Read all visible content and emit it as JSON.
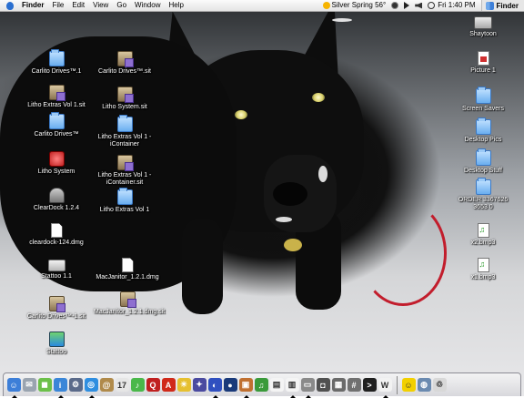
{
  "menubar": {
    "app_name": "Finder",
    "menus": [
      "File",
      "Edit",
      "View",
      "Go",
      "Window",
      "Help"
    ],
    "weather": "Silver Spring 56°",
    "clock": "Fri 1:40 PM",
    "active_app": "Finder"
  },
  "desktop_icons": [
    {
      "label": "Carlito Drives™.1",
      "type": "folder"
    },
    {
      "label": "Carlito Drives™.sit",
      "type": "sit"
    },
    {
      "label": "Litho Extras Vol 1.sit",
      "type": "sit"
    },
    {
      "label": "Litho System.sit",
      "type": "sit"
    },
    {
      "label": "Carlito Drives™",
      "type": "folder"
    },
    {
      "label": "Litho Extras Vol 1 - iContainer",
      "type": "folder"
    },
    {
      "label": "Litho System",
      "type": "app"
    },
    {
      "label": "Litho Extras Vol 1 - iContainer.sit",
      "type": "sit"
    },
    {
      "label": "ClearDock 1.2.4",
      "type": "app"
    },
    {
      "label": "Litho Extras Vol 1",
      "type": "folder"
    },
    {
      "label": "cleardock-124.dmg",
      "type": "doc"
    },
    {
      "label": "Stattoo 1.1",
      "type": "disk"
    },
    {
      "label": "MacJanitor_1.2.1.dmg",
      "type": "doc"
    },
    {
      "label": "Carlito Drives™-1.sit",
      "type": "sit"
    },
    {
      "label": "MacJanitor_1.2.1.dmg.sit",
      "type": "sit"
    },
    {
      "label": "Stattoo",
      "type": "app"
    },
    {
      "label": "Shaytoon",
      "type": "hd"
    },
    {
      "label": "Picture 1",
      "type": "pict"
    },
    {
      "label": "Screen Savers",
      "type": "folder"
    },
    {
      "label": "Desktop Pics",
      "type": "folder"
    },
    {
      "label": "Desktop Stuff",
      "type": "folder"
    },
    {
      "label": "ORDER 3367626 3653 0",
      "type": "folder"
    },
    {
      "label": "x2.bmp3",
      "type": "mp3"
    },
    {
      "label": "x1.bmp3",
      "type": "mp3"
    }
  ],
  "dock": {
    "items": [
      {
        "name": "finder",
        "color": "#3d7fd8",
        "glyph": "☺"
      },
      {
        "name": "mail",
        "color": "#9aa4b0",
        "glyph": "✉"
      },
      {
        "name": "ichat",
        "color": "#6cc04a",
        "glyph": "◼"
      },
      {
        "name": "info",
        "color": "#3a86d8",
        "glyph": "i"
      },
      {
        "name": "system-preferences",
        "color": "#5a6a8a",
        "glyph": "⚙"
      },
      {
        "name": "safari",
        "color": "#2f8ee0",
        "glyph": "◎"
      },
      {
        "name": "address-book",
        "color": "#b08a4a",
        "glyph": "@"
      },
      {
        "name": "ical",
        "color": "#e6e6e6",
        "glyph": "17"
      },
      {
        "name": "itunes",
        "color": "#4ab84a",
        "glyph": "♪"
      },
      {
        "name": "quicktime",
        "color": "#c02020",
        "glyph": "Q"
      },
      {
        "name": "acrobat",
        "color": "#d02a1a",
        "glyph": "A"
      },
      {
        "name": "weather",
        "color": "#e6c030",
        "glyph": "☀"
      },
      {
        "name": "network",
        "color": "#4a4aa0",
        "glyph": "✦"
      },
      {
        "name": "sync",
        "color": "#3050c0",
        "glyph": "◐"
      },
      {
        "name": "firewire",
        "color": "#1a3a7a",
        "glyph": "●"
      },
      {
        "name": "photo",
        "color": "#c07030",
        "glyph": "▣"
      },
      {
        "name": "music-doc",
        "color": "#3a9a3a",
        "glyph": "♫"
      },
      {
        "name": "preview",
        "color": "#f4f4f4",
        "glyph": "▤"
      },
      {
        "name": "chart",
        "color": "#f4f4f4",
        "glyph": "▥"
      },
      {
        "name": "printer",
        "color": "#8a8a8a",
        "glyph": "▭"
      },
      {
        "name": "image-capture",
        "color": "#505050",
        "glyph": "◘"
      },
      {
        "name": "disk-utility",
        "color": "#6a6a6a",
        "glyph": "▦"
      },
      {
        "name": "calculator",
        "color": "#707070",
        "glyph": "#"
      },
      {
        "name": "terminal",
        "color": "#202020",
        "glyph": ">"
      },
      {
        "name": "textedit",
        "color": "#f2f2f2",
        "glyph": "W"
      },
      {
        "name": "smiley",
        "color": "#f2d000",
        "glyph": "☺"
      },
      {
        "name": "globe",
        "color": "#6a8ab0",
        "glyph": "◍"
      },
      {
        "name": "trash",
        "color": "#d8d8d8",
        "glyph": "♲"
      }
    ]
  }
}
